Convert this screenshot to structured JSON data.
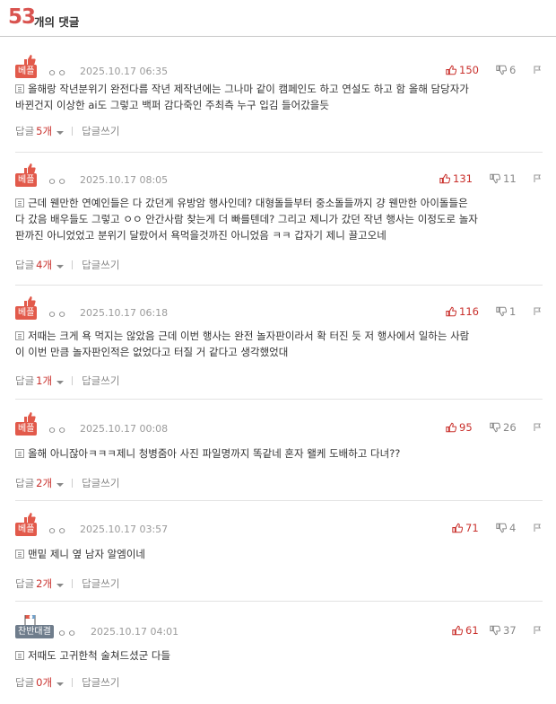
{
  "header": {
    "count": "53",
    "label": "개의 댓글"
  },
  "ui": {
    "reply_label": "답글",
    "write_reply": "답글쓰기"
  },
  "colors": {
    "accent": "#d9534f",
    "badge_red": "#e25a4b",
    "badge_gray": "#6f7d8c"
  },
  "comments": [
    {
      "badge": "베플",
      "author": "ㅇㅇ",
      "date": "2025.10.17 06:35",
      "likes": "150",
      "dislikes": "6",
      "lines": [
        "올해랑 작년분위기 완전다름 작년 제작년에는 그나마 같이 캠페인도 하고 연설도 하고 함 올해 담당자가",
        "바뀐건지 이상한 ai도 그렇고 백퍼 감다죽인 주최측 누구 입김 들어갔을듯"
      ],
      "reply_count": "5개"
    },
    {
      "badge": "베플",
      "author": "ㅇㅇ",
      "date": "2025.10.17 08:05",
      "likes": "131",
      "dislikes": "11",
      "lines": [
        "근데 웬만한 연예인들은 다 갔던게 유방암 행사인데? 대형돌들부터 중소돌들까지 걍 웬만한 아이돌들은",
        "다 갔음 배우들도 그렇고 ㅇㅇ 안간사람 찾는게 더 빠를텐데? 그리고 제니가 갔던 작년 행사는 이정도로 놀자",
        "판까진 아니었었고 분위기 달랐어서 욕먹을것까진 아니었음 ㅋㅋ 갑자기 제니 끌고오네"
      ],
      "reply_count": "4개"
    },
    {
      "badge": "베플",
      "author": "ㅇㅇ",
      "date": "2025.10.17 06:18",
      "likes": "116",
      "dislikes": "1",
      "lines": [
        "저때는 크게 욕 먹지는 않았음 근데 이번 행사는 완전 놀자판이라서 확 터진 듯 저 행사에서 일하는 사람",
        "이 이번 만큼 놀자판인적은 없었다고 터질 거 같다고 생각했었대"
      ],
      "reply_count": "1개"
    },
    {
      "badge": "베플",
      "author": "ㅇㅇ",
      "date": "2025.10.17 00:08",
      "likes": "95",
      "dislikes": "26",
      "lines": [
        "올해 아니잖아ㅋㅋㅋ제니 청병줌아 사진 파일명까지 똑같네 혼자 왤케 도배하고 다녀??"
      ],
      "reply_count": "2개"
    },
    {
      "badge": "베플",
      "author": "ㅇㅇ",
      "date": "2025.10.17 03:57",
      "likes": "71",
      "dislikes": "4",
      "lines": [
        "맨밑 제니 옆 남자 알엠이네"
      ],
      "reply_count": "2개"
    },
    {
      "badge": "찬반대결",
      "author": "ㅇㅇ",
      "date": "2025.10.17 04:01",
      "likes": "61",
      "dislikes": "37",
      "lines": [
        "저때도 고귀한척 술쳐드셨군 다들"
      ],
      "reply_count": "0개"
    }
  ]
}
